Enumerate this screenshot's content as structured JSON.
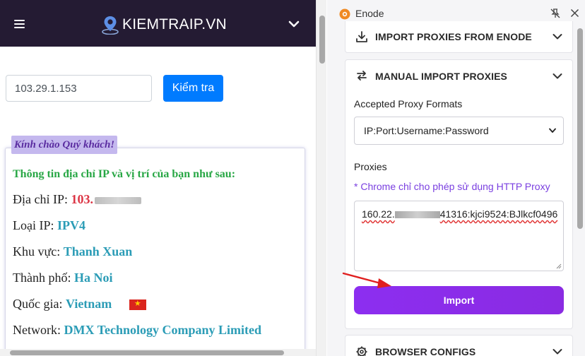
{
  "site": {
    "brand": "KIEMTRAIP.VN",
    "search": {
      "value": "103.29.1.153"
    },
    "check_button": "Kiểm tra",
    "greeting": "Kính chào Quý khách!",
    "info_heading": "Thông tin địa chỉ IP và vị trí của bạn như sau:",
    "rows": [
      {
        "label": "Địa chỉ IP:",
        "value": "103."
      },
      {
        "label": "Loại IP:",
        "value": "IPV4"
      },
      {
        "label": "Khu vực:",
        "value": "Thanh Xuan"
      },
      {
        "label": "Thành phố:",
        "value": "Ha Noi"
      },
      {
        "label": "Quốc gia:",
        "value": "Vietnam"
      },
      {
        "label": "Network:",
        "value": "DMX Technology Company Limited"
      }
    ]
  },
  "extension": {
    "title": "Enode",
    "sections": {
      "import_enode": "IMPORT PROXIES FROM ENODE",
      "manual": "MANUAL IMPORT PROXIES",
      "browser": "BROWSER CONFIGS"
    },
    "formats_label": "Accepted Proxy Formats",
    "format_selected": "IP:Port:Username:Password",
    "proxies_label": "Proxies",
    "note": "* Chrome chỉ cho phép sử dụng HTTP Proxy",
    "proxy_prefix": "160.22.",
    "proxy_suffix": "41316:kjci9524:BJlkcf0496",
    "import_button": "Import"
  },
  "colors": {
    "header_bg": "#241b33",
    "check_button": "#007bff",
    "import_button": "#8a2be2",
    "accent_text": "#7a3fe0",
    "value_text": "#2b9cb6",
    "ip_text": "#dc3545",
    "heading_text": "#28a745"
  }
}
